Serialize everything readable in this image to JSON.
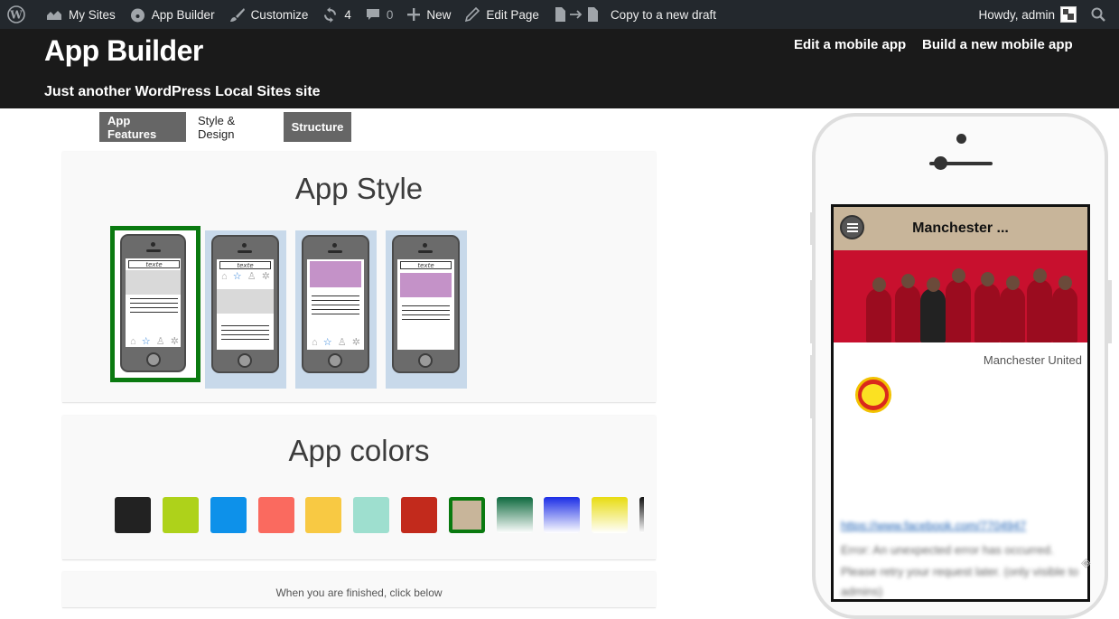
{
  "admin_bar": {
    "wp_logo": "wordpress-icon",
    "my_sites": "My Sites",
    "app_builder": "App Builder",
    "customize": "Customize",
    "updates": "4",
    "comments": "0",
    "new": "New",
    "edit_page": "Edit Page",
    "copy_draft": "Copy to a new draft",
    "howdy": "Howdy, admin"
  },
  "site": {
    "title": "App Builder",
    "description": "Just another WordPress Local Sites site",
    "nav": [
      "Edit a mobile app",
      "Build a new mobile app"
    ]
  },
  "tabs": [
    "App Features",
    "Style & Design",
    "Structure"
  ],
  "active_tab": "Style & Design",
  "app_style": {
    "title": "App Style",
    "options": [
      {
        "id": "style-1",
        "header_text": "texte",
        "selected": true
      },
      {
        "id": "style-2",
        "header_text": "texte",
        "selected": false
      },
      {
        "id": "style-3",
        "header_text": "",
        "selected": false
      },
      {
        "id": "style-4",
        "header_text": "texte",
        "selected": false
      }
    ]
  },
  "app_colors": {
    "title": "App colors",
    "swatches": [
      "#222222",
      "#aed21a",
      "#0d91ea",
      "#fa6a5f",
      "#f8c943",
      "#9edfcf",
      "#c22a1c",
      "#c8b59a",
      "gradient-green",
      "gradient-blue",
      "gradient-yellow",
      "gradient-black"
    ],
    "selected": "#c8b59a"
  },
  "panel3_text": "When you are finished, click below",
  "preview": {
    "app_title": "Manchester ...",
    "club_name": "Manchester United",
    "link": "https://www.facebook.com/7704947",
    "error_1": "Error: An unexpected error has occurred.",
    "error_2": "Please retry your request later. (only visible to",
    "error_3": "admins)"
  },
  "colors": {
    "selected_border": "#0a7a10",
    "admin_bar": "#23282d",
    "header_bg": "#1a1a1a",
    "app_bar": "#c8b59a"
  }
}
